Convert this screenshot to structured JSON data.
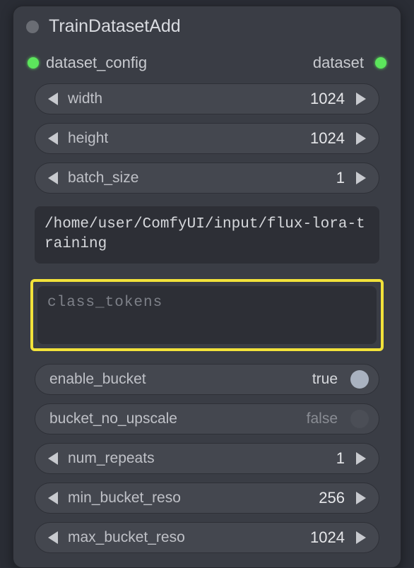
{
  "node": {
    "title": "TrainDatasetAdd",
    "input_port_label": "dataset_config",
    "output_port_label": "dataset"
  },
  "widgets": {
    "width": {
      "label": "width",
      "value": "1024"
    },
    "height": {
      "label": "height",
      "value": "1024"
    },
    "batch_size": {
      "label": "batch_size",
      "value": "1"
    },
    "path": "/home/user/ComfyUI/input/flux-lora-training",
    "class_tokens_placeholder": "class_tokens",
    "enable_bucket": {
      "label": "enable_bucket",
      "value": "true",
      "on": true
    },
    "bucket_no_upscale": {
      "label": "bucket_no_upscale",
      "value": "false",
      "on": false
    },
    "num_repeats": {
      "label": "num_repeats",
      "value": "1"
    },
    "min_reso": {
      "label": "min_bucket_reso",
      "value": "256"
    },
    "max_reso": {
      "label": "max_bucket_reso",
      "value": "1024"
    }
  }
}
